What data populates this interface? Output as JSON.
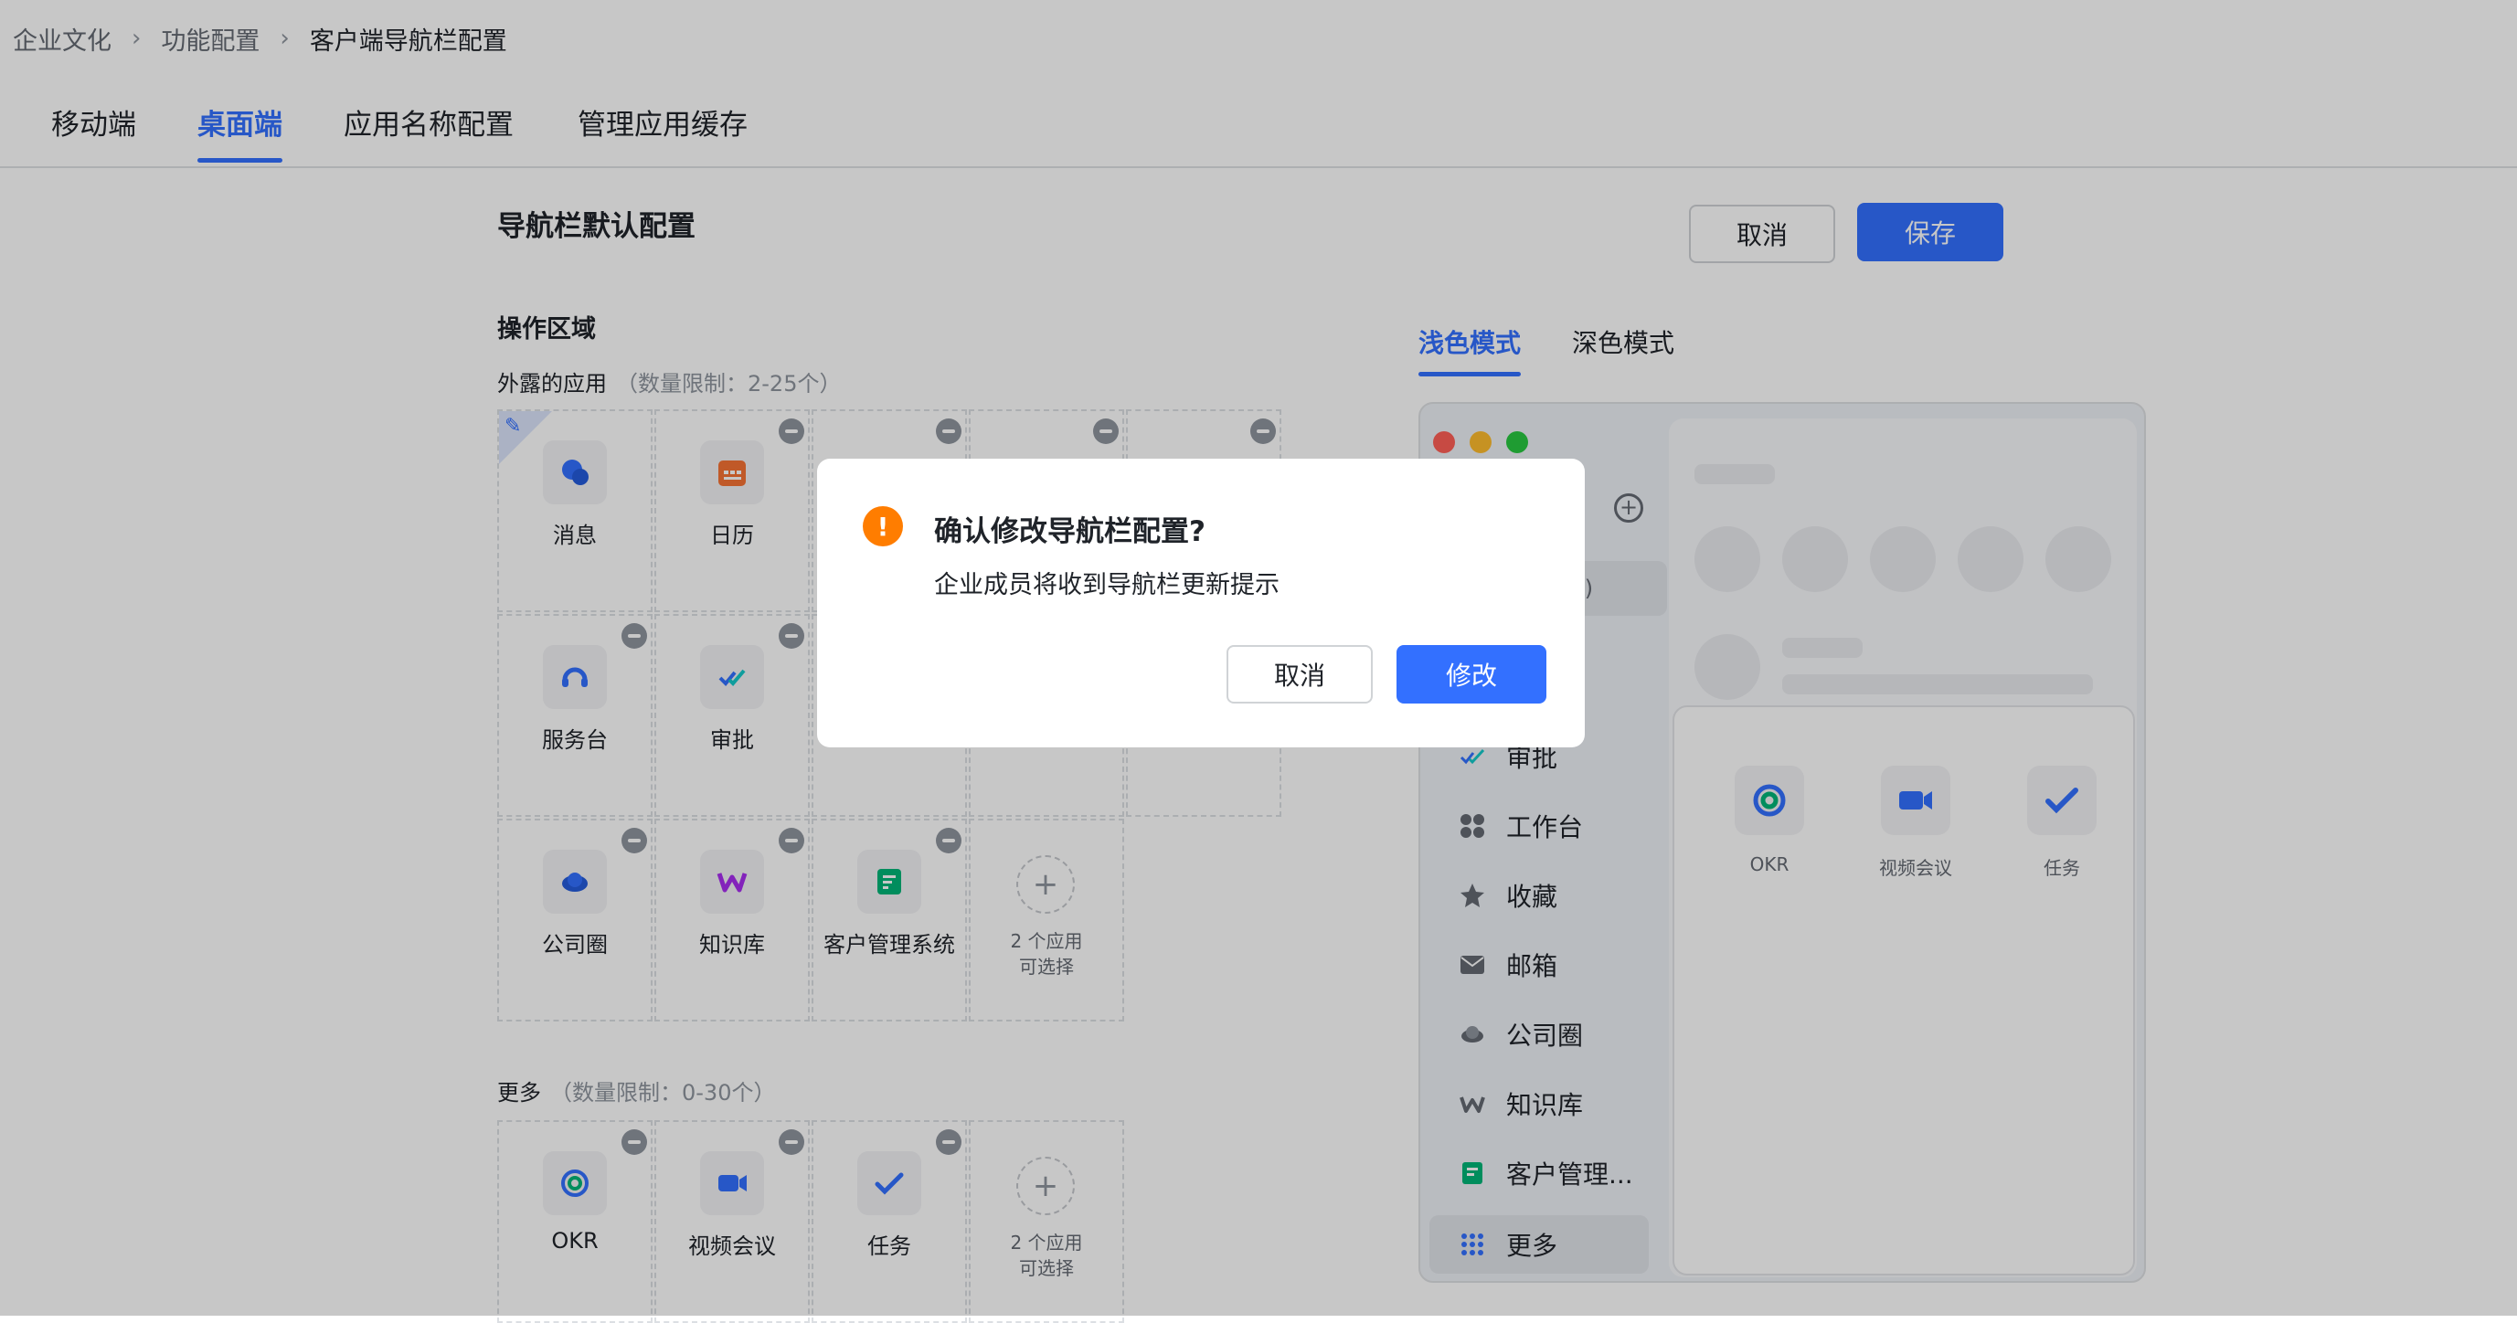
{
  "breadcrumb": [
    "企业文化",
    "功能配置",
    "客户端导航栏配置"
  ],
  "tabs": [
    "移动端",
    "桌面端",
    "应用名称配置",
    "管理应用缓存"
  ],
  "header": {
    "title": "导航栏默认配置",
    "cancel": "取消",
    "save": "保存"
  },
  "operation_area": "操作区域",
  "exposed": {
    "label": "外露的应用",
    "limit": "（数量限制：2-25个）",
    "apps": [
      "消息",
      "日历",
      "服务台",
      "审批",
      "公司圈",
      "知识库",
      "客户管理系统"
    ],
    "add_line1": "2 个应用",
    "add_line2": "可选择"
  },
  "more_section": {
    "label": "更多",
    "limit": "（数量限制：0-30个）",
    "apps": [
      "OKR",
      "视频会议",
      "任务"
    ],
    "add_line1": "2 个应用",
    "add_line2": "可选择"
  },
  "preview": {
    "mode_tabs": [
      "浅色模式",
      "深色模式"
    ],
    "search_hint": "K)",
    "nav_items": [
      "审批",
      "工作台",
      "收藏",
      "邮箱",
      "公司圈",
      "知识库",
      "客户管理...",
      "更多"
    ],
    "more_panel_apps": [
      "OKR",
      "视频会议",
      "任务"
    ]
  },
  "modal": {
    "title": "确认修改导航栏配置?",
    "description": "企业成员将收到导航栏更新提示",
    "cancel": "取消",
    "confirm": "修改"
  },
  "colors": {
    "accent": "#3370ff",
    "warning": "#ff7d00",
    "overlay": "rgba(0,0,0,0.22)"
  },
  "icons": {
    "breadcrumb_separator": "chevron-right-icon",
    "exposed_apps": [
      "message-icon",
      "calendar-icon",
      "helpdesk-icon",
      "approval-icon",
      "moments-icon",
      "wiki-icon",
      "crm-icon"
    ],
    "more_apps": [
      "okr-icon",
      "video-meeting-icon",
      "task-icon"
    ]
  }
}
